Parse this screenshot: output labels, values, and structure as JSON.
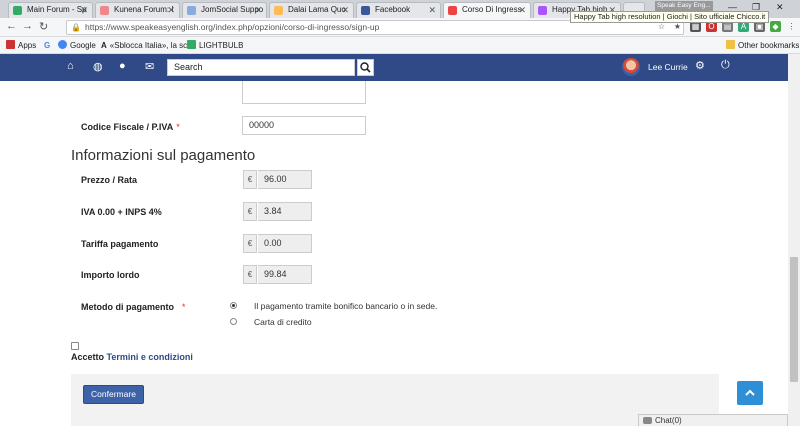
{
  "browser": {
    "tabs": [
      {
        "title": "Main Forum - Sp",
        "favicon": "#3a6"
      },
      {
        "title": "Kunena Forum: I",
        "favicon": "#e88"
      },
      {
        "title": "JomSocial Suppo",
        "favicon": "#8ad"
      },
      {
        "title": "Dalai Lama Quo",
        "favicon": "#fb5"
      },
      {
        "title": "Facebook",
        "favicon": "#3b5998"
      },
      {
        "title": "Corso Di Ingress",
        "favicon": "#e44"
      },
      {
        "title": "Happy Tab high",
        "favicon": "#a5f"
      }
    ],
    "tooltip": "Happy Tab high resolution | Giochi | Sito ufficiale Chicco.it",
    "corner_tab": "Speak Easy Eng...",
    "url": "https://www.speakeasyenglish.org/index.php/opzioni/corso-di-ingresso/sign-up",
    "bookmarks": [
      {
        "label": "Apps",
        "color": "#c33"
      },
      {
        "label": "G",
        "color": "#4285f4"
      },
      {
        "label": "Google",
        "color": "#4285f4"
      },
      {
        "label": "«Sblocca Italia», la sch",
        "color": "#222"
      },
      {
        "label": "LIGHTBULB",
        "color": "#3a6"
      }
    ],
    "other_bookmarks": "Other bookmarks"
  },
  "sitenav": {
    "search_placeholder": "Search",
    "user_name": "Lee Currie"
  },
  "form": {
    "codice_fiscale_label": "Codice Fiscale / P.IVA",
    "codice_fiscale_value": "00000",
    "required_mark": "*",
    "section_title": "Informazioni sul pagamento",
    "currency": "€",
    "rows": [
      {
        "label": "Prezzo / Rata",
        "value": "96.00"
      },
      {
        "label": "IVA 0.00 + INPS 4%",
        "value": "3.84"
      },
      {
        "label": "Tariffa pagamento",
        "value": "0.00"
      },
      {
        "label": "Importo lordo",
        "value": "99.84"
      }
    ],
    "payment_method_label": "Metodo di pagamento",
    "payment_options": [
      "Il pagamento tramite bonifico bancario o in sede.",
      "Carta di credito"
    ],
    "accept_prefix": "Accetto",
    "terms_link": "Termini e condizioni",
    "confirm_label": "Confermare"
  },
  "chat": {
    "label": "Chat(0)"
  }
}
